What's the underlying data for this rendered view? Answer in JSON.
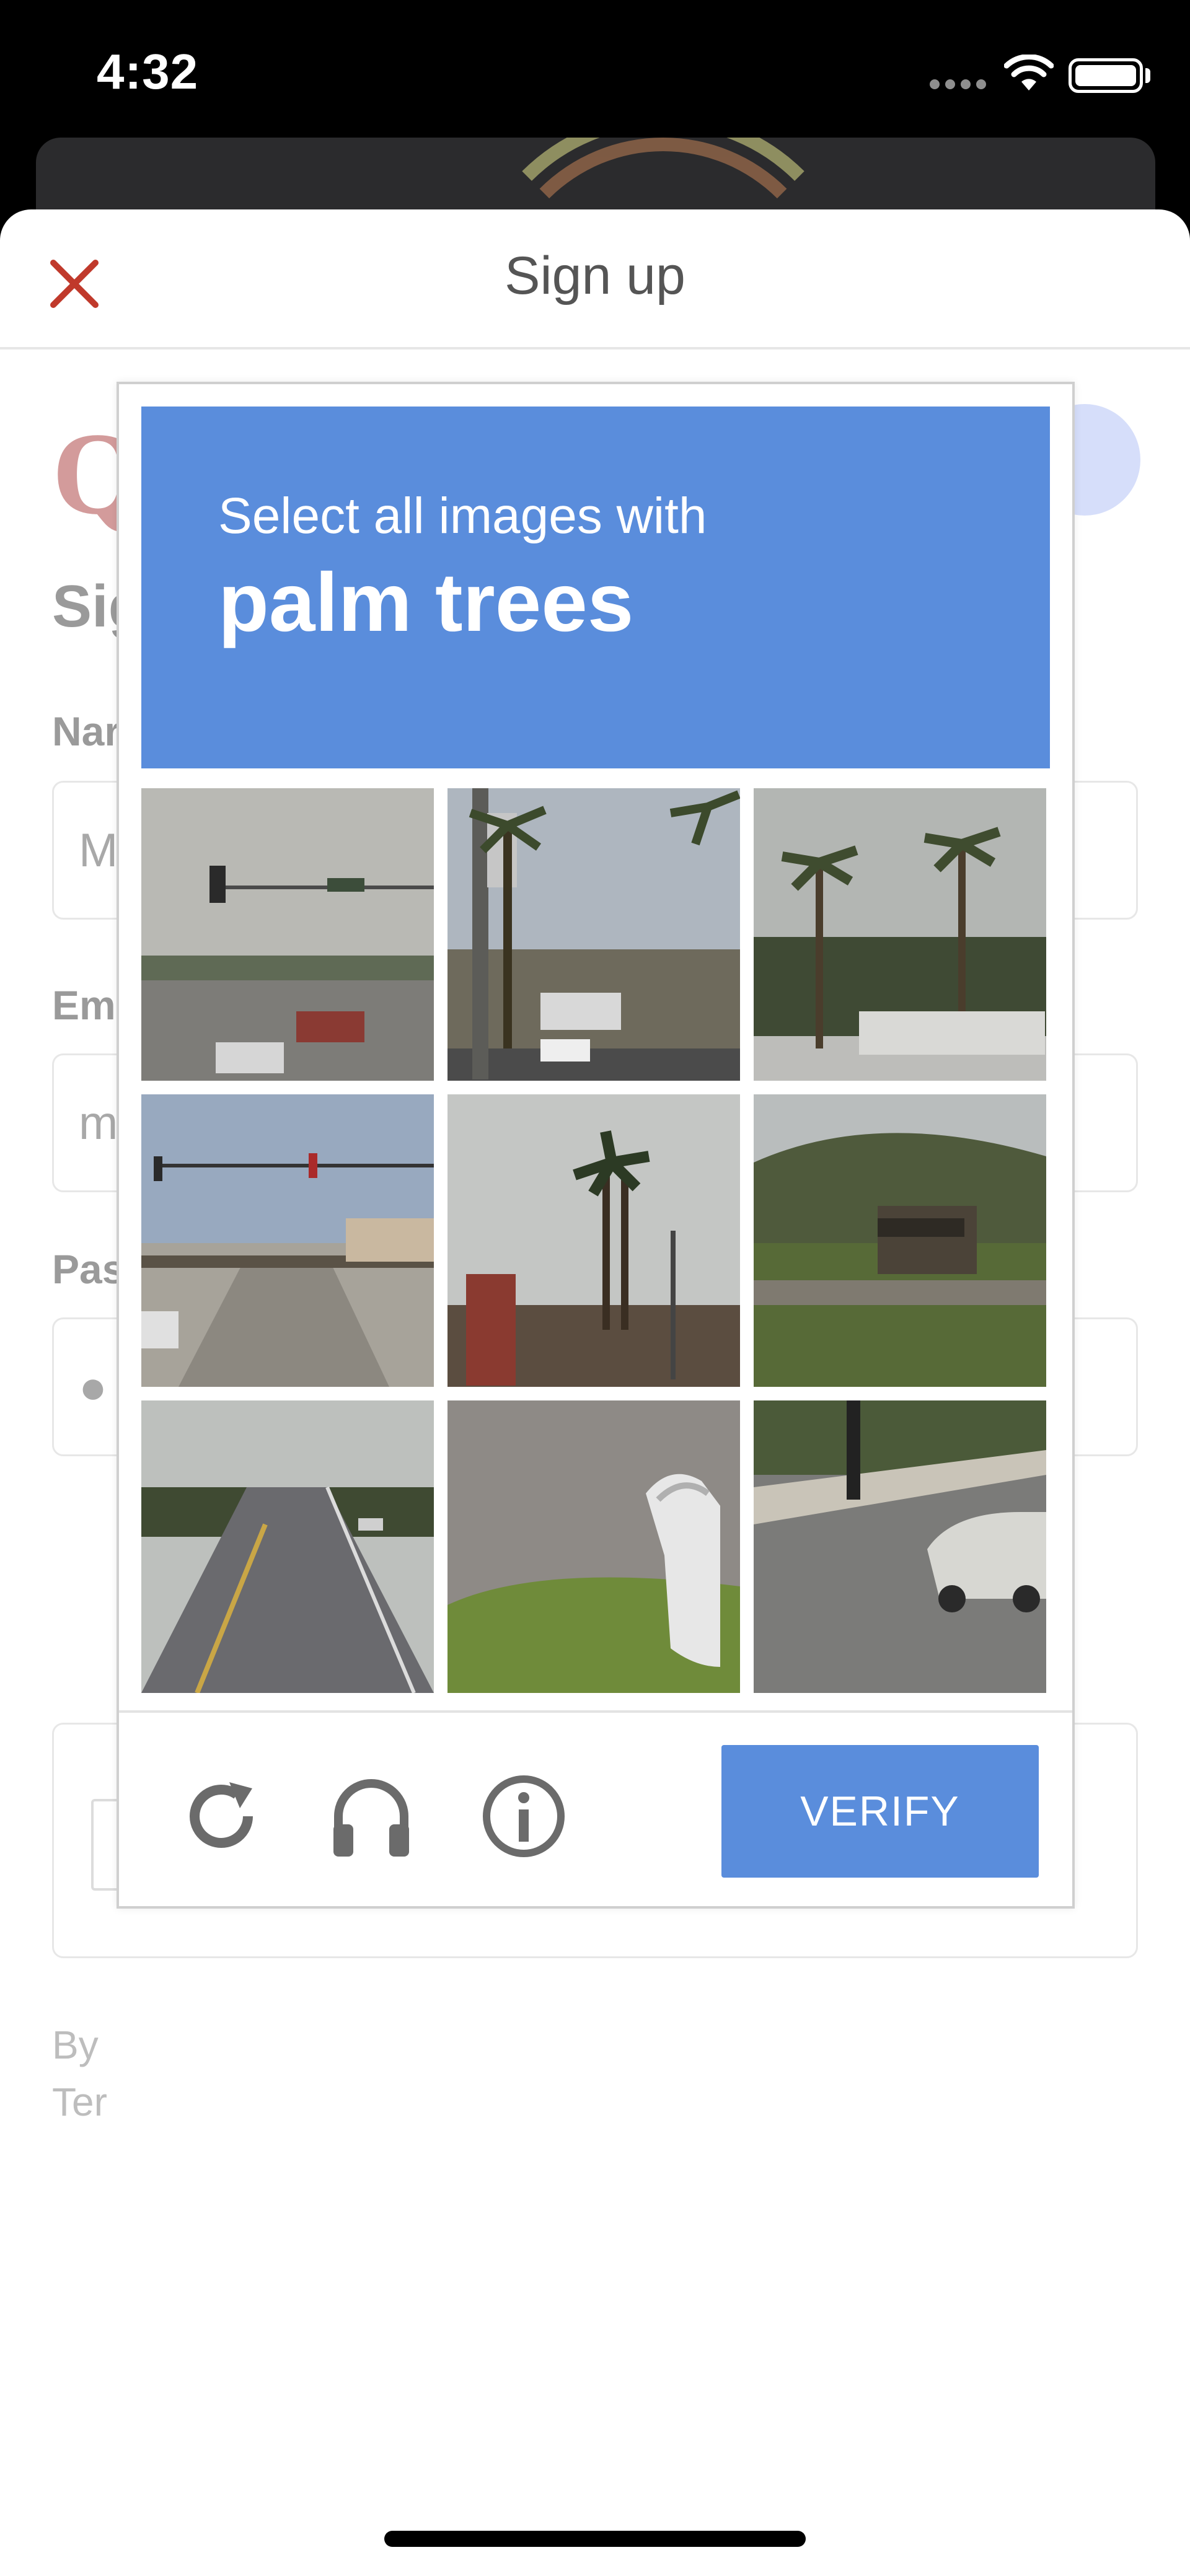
{
  "status_bar": {
    "time": "4:32"
  },
  "sheet": {
    "title": "Sign up"
  },
  "form": {
    "heading": "Sig",
    "name_label": "Nar",
    "name_value": "M",
    "email_label": "Em",
    "email_value": "m",
    "password_label": "Pas",
    "password_value": "●",
    "terms_line1": "By",
    "terms_line2": "Ter"
  },
  "captcha": {
    "instruction": "Select all images with",
    "target": "palm trees",
    "verify_label": "VERIFY",
    "accent_color": "#5a8ddc",
    "icons": [
      "reload-icon",
      "headphones-icon",
      "info-icon"
    ]
  },
  "colors": {
    "close": "#c0392b",
    "captcha_blue": "#5a8ddc"
  }
}
